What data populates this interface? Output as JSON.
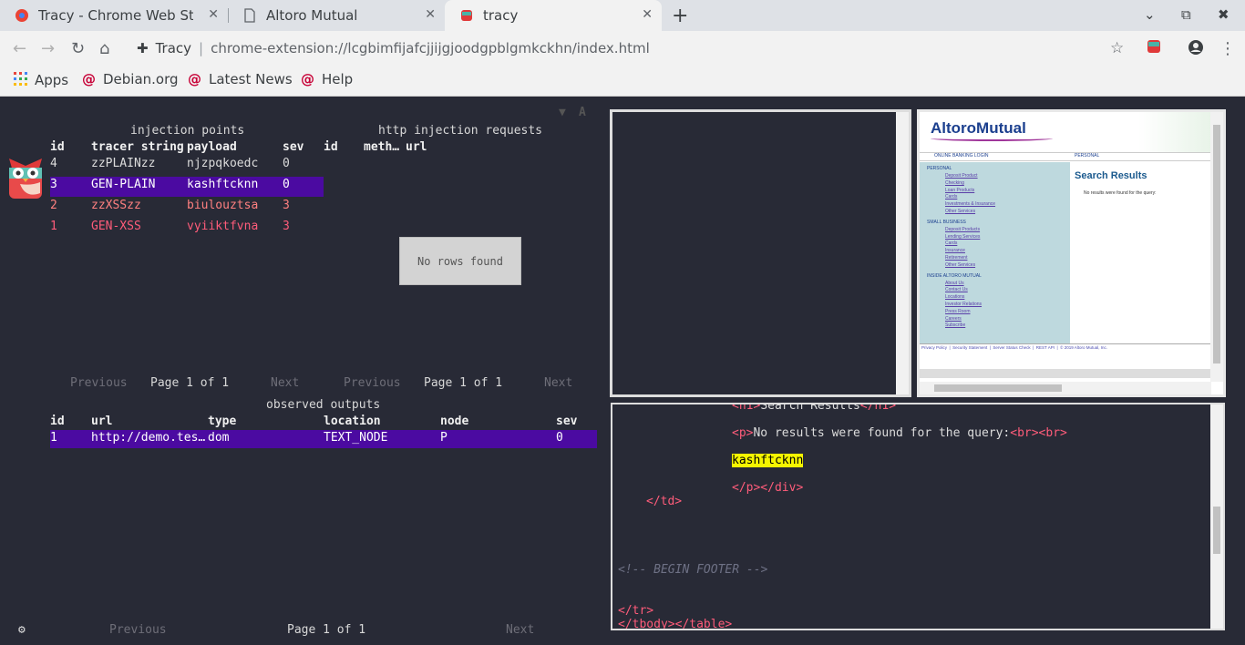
{
  "browser": {
    "tabs": [
      {
        "title": "Tracy - Chrome Web Store",
        "close": "✕"
      },
      {
        "title": "Altoro Mutual",
        "close": "✕"
      },
      {
        "title": "tracy",
        "close": "✕"
      }
    ],
    "new_tab": "+",
    "omnibox": {
      "extension_label": "Tracy",
      "separator": "|",
      "url": "chrome-extension://lcgbimfijafcjjijgjoodgpblgmkckhn/index.html"
    },
    "bookmarks": [
      {
        "label": "Apps"
      },
      {
        "label": "Debian.org"
      },
      {
        "label": "Latest News"
      },
      {
        "label": "Help"
      }
    ]
  },
  "injection_points": {
    "title": "injection points",
    "columns": [
      "id",
      "tracer string",
      "payload",
      "sev"
    ],
    "rows": [
      {
        "id": "4",
        "tracer": "zzPLAINzz",
        "payload": "njzpqkoedc",
        "sev": "0",
        "style": "normal"
      },
      {
        "id": "3",
        "tracer": "GEN-PLAIN",
        "payload": "kashftcknn",
        "sev": "0",
        "style": "selected"
      },
      {
        "id": "2",
        "tracer": "zzXSSzz",
        "payload": "biulouztsa",
        "sev": "3",
        "style": "warn"
      },
      {
        "id": "1",
        "tracer": "GEN-XSS",
        "payload": "vyiiktfvna",
        "sev": "3",
        "style": "danger"
      }
    ],
    "pager": {
      "prev": "Previous",
      "page": "Page 1 of 1",
      "next": "Next"
    }
  },
  "http_requests": {
    "title": "http injection requests",
    "columns": [
      "id",
      "meth…",
      "url"
    ],
    "empty": "No rows found",
    "pager": {
      "prev": "Previous",
      "page": "Page 1 of 1",
      "next": "Next"
    }
  },
  "observed_outputs": {
    "title": "observed outputs",
    "columns": [
      "id",
      "url",
      "type",
      "location",
      "node",
      "sev"
    ],
    "rows": [
      {
        "id": "1",
        "url": "http://demo.tes…",
        "type": "dom",
        "location": "TEXT_NODE",
        "node": "P",
        "sev": "0"
      }
    ],
    "pager": {
      "prev": "Previous",
      "page": "Page 1 of 1",
      "next": "Next"
    }
  },
  "preview": {
    "logo": "AltoroMutual",
    "login_link": "ONLINE BANKING LOGIN",
    "personal_tab": "PERSONAL",
    "heading": "Search Results",
    "message": "No results were found for the query:",
    "sections": [
      {
        "title": "PERSONAL",
        "links": [
          "Deposit Product",
          "Checking",
          "Loan Products",
          "Cards",
          "Investments & Insurance",
          "Other Services"
        ]
      },
      {
        "title": "SMALL BUSINESS",
        "links": [
          "Deposit Products",
          "Lending Services",
          "Cards",
          "Insurance",
          "Retirement",
          "Other Services"
        ]
      },
      {
        "title": "INSIDE ALTORO MUTUAL",
        "links": [
          "About Us",
          "Contact Us",
          "Locations",
          "Investor Relations",
          "Press Room",
          "Careers",
          "Subscribe"
        ]
      }
    ],
    "footer": "Privacy Policy  |  Security Statement  |  Server Status Check  |  REST API  |  © 2019 Altoro Mutual, Inc."
  },
  "code": {
    "line1_text": "Search Results",
    "line2_text": "No results were found for the query:",
    "highlight": "kashftcknn",
    "comment": "<!-- BEGIN FOOTER -->"
  },
  "colors": {
    "selected": "#4b0aa1",
    "warn": "#ff8080",
    "danger": "#ff5c7a",
    "highlight": "#f6f600"
  }
}
